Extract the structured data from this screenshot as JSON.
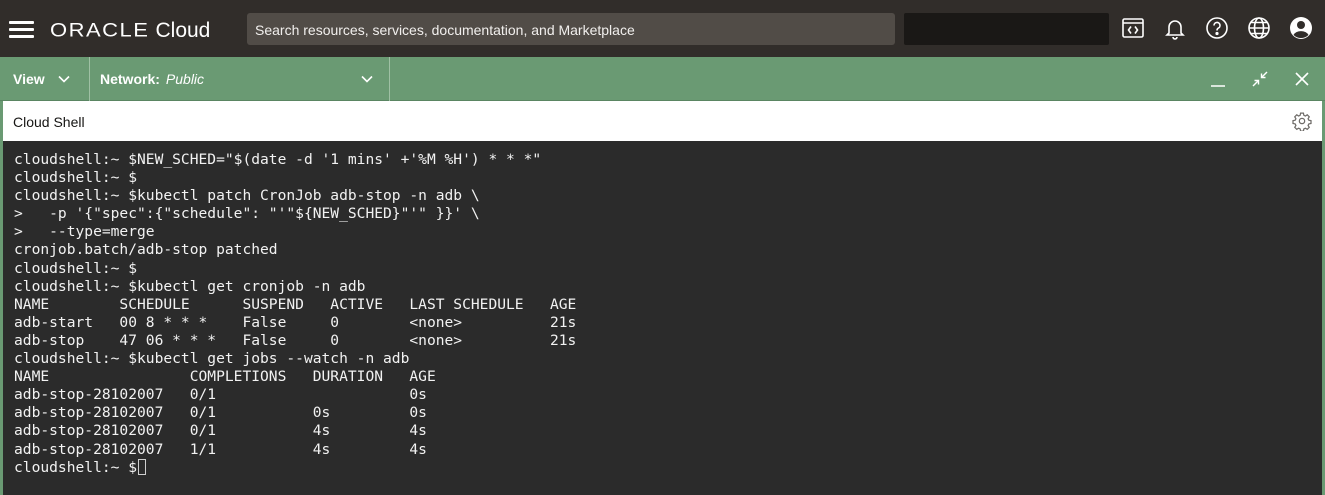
{
  "header": {
    "brand": "ORACLE",
    "product": "Cloud",
    "search_placeholder": "Search resources, services, documentation, and Marketplace",
    "icons": [
      "hamburger-menu-icon",
      "code-editor-icon",
      "bell-icon",
      "help-icon",
      "globe-icon",
      "user-avatar-icon"
    ]
  },
  "shell_bar": {
    "view_label": "View",
    "network_label": "Network:",
    "network_value": "Public",
    "icons": [
      "minimize-icon",
      "restore-icon",
      "close-icon"
    ]
  },
  "panel": {
    "title": "Cloud Shell",
    "icon": "settings-gear-icon"
  },
  "terminal": {
    "lines": [
      "cloudshell:~ $NEW_SCHED=\"$(date -d '1 mins' +'%M %H') * * *\"",
      "cloudshell:~ $",
      "cloudshell:~ $kubectl patch CronJob adb-stop -n adb \\",
      ">   -p '{\"spec\":{\"schedule\": \"'\"${NEW_SCHED}\"'\" }}' \\",
      ">   --type=merge",
      "cronjob.batch/adb-stop patched",
      "cloudshell:~ $",
      "cloudshell:~ $kubectl get cronjob -n adb",
      "NAME        SCHEDULE      SUSPEND   ACTIVE   LAST SCHEDULE   AGE",
      "adb-start   00 8 * * *    False     0        <none>          21s",
      "adb-stop    47 06 * * *   False     0        <none>          21s",
      "cloudshell:~ $kubectl get jobs --watch -n adb",
      "NAME                COMPLETIONS   DURATION   AGE",
      "adb-stop-28102007   0/1                      0s",
      "adb-stop-28102007   0/1           0s         0s",
      "adb-stop-28102007   0/1           4s         4s",
      "adb-stop-28102007   1/1           4s         4s"
    ],
    "prompt": "cloudshell:~ $"
  },
  "colors": {
    "topbar": "#312d2a",
    "shell_bar": "#6a9a73",
    "terminal_bg": "#2b2b2b",
    "terminal_fg": "#f2f2f2"
  }
}
